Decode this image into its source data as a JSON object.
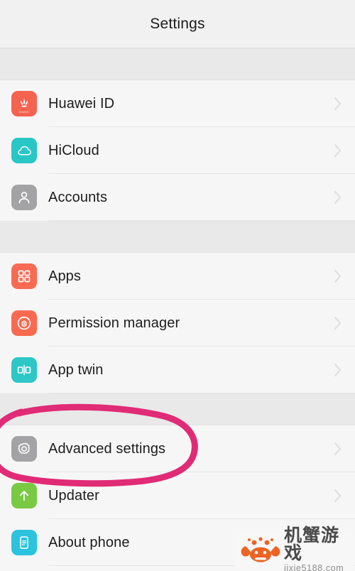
{
  "header": {
    "title": "Settings"
  },
  "colors": {
    "page_background": "#f6f6f6",
    "header_background": "#f1f1f1",
    "group_spacer": "#e9e9e9",
    "separator": "#e7e7e7",
    "text_primary": "#1d1d1d",
    "chevron": "#c9c9c9",
    "annotation_pink": "#e02b76",
    "icon_huawei_red": "#f4634f",
    "icon_hicloud_teal": "#29c6c6",
    "icon_accounts_gray": "#a3a3a6",
    "icon_apps_orange": "#f96a52",
    "icon_permission_orange": "#fa6a50",
    "icon_apptwin_teal": "#2ec7c7",
    "icon_advanced_gray": "#a3a3a6",
    "icon_updater_green": "#7ac943",
    "icon_about_cyan": "#2bc3dd"
  },
  "groups": [
    {
      "name": "account-group",
      "rows": [
        {
          "label": "Huawei ID",
          "icon": "huawei-logo-icon",
          "icon_color": "#f4634f",
          "chevron": "chevron-right-icon"
        },
        {
          "label": "HiCloud",
          "icon": "cloud-icon",
          "icon_color": "#29c6c6",
          "chevron": "chevron-right-icon"
        },
        {
          "label": "Accounts",
          "icon": "person-icon",
          "icon_color": "#a3a3a6",
          "chevron": "chevron-right-icon"
        }
      ]
    },
    {
      "name": "apps-group",
      "rows": [
        {
          "label": "Apps",
          "icon": "grid-squares-icon",
          "icon_color": "#f96a52",
          "chevron": "chevron-right-icon"
        },
        {
          "label": "Permission manager",
          "icon": "lock-circle-icon",
          "icon_color": "#fa6a50",
          "chevron": "chevron-right-icon"
        },
        {
          "label": "App twin",
          "icon": "app-twin-icon",
          "icon_color": "#2ec7c7",
          "chevron": "chevron-right-icon"
        }
      ]
    },
    {
      "name": "system-group",
      "rows": [
        {
          "label": "Advanced settings",
          "icon": "gear-icon",
          "icon_color": "#a3a3a6",
          "chevron": "chevron-right-icon",
          "highlighted": true
        },
        {
          "label": "Updater",
          "icon": "arrow-up-icon",
          "icon_color": "#7ac943",
          "chevron": "chevron-right-icon"
        },
        {
          "label": "About phone",
          "icon": "phone-info-icon",
          "icon_color": "#2bc3dd",
          "chevron": "chevron-right-icon"
        }
      ]
    }
  ],
  "annotation": {
    "name": "advanced-settings-highlight-circle",
    "shape": "hand-drawn-ellipse",
    "color": "#e02b76",
    "targets": "Advanced settings"
  },
  "watermark": {
    "brand_cn": "机蟹游戏",
    "url": "jixie5188.com",
    "icon": "crab-icon",
    "crab_color": "#ec6322"
  },
  "icon_text": {
    "huawei_wordmark": "HUAWEI"
  }
}
